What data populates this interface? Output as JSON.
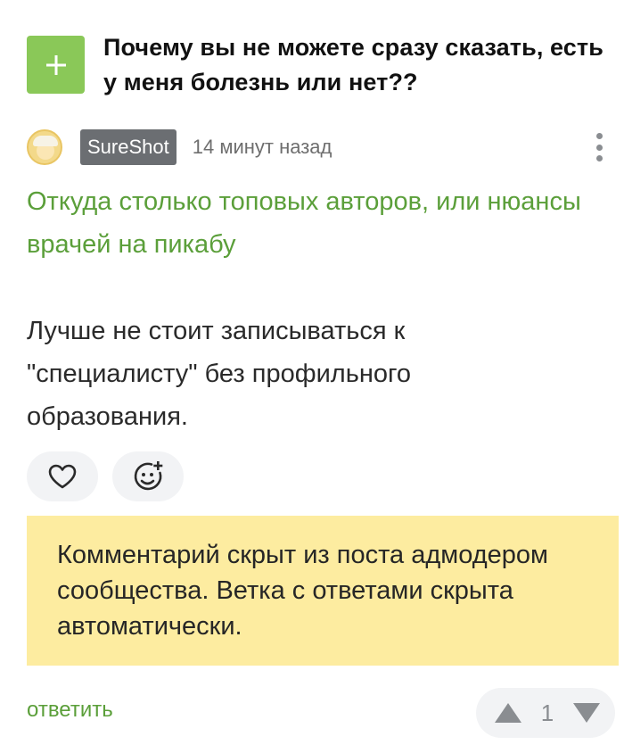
{
  "post": {
    "title": "Почему вы не можете сразу сказать, есть у меня болезнь или нет??"
  },
  "comment": {
    "username": "SureShot",
    "time": "14 минут назад",
    "quote_link": "Откуда столько топовых авторов, или нюансы врачей на пикабу",
    "body": "Лучше не стоит записываться к \"специалисту\" без профильного образования."
  },
  "hidden_notice": "Комментарий скрыт из поста адмодером сообщества. Ветка с ответами скрыта автоматически.",
  "footer": {
    "reply_label": "ответить",
    "rating": "1"
  },
  "colors": {
    "accent_green": "#8ac858",
    "link_green": "#5b9f3a",
    "notice_yellow": "#fdeca0",
    "username_badge": "#6b6e72"
  },
  "icons": [
    "plus-icon",
    "avatar",
    "more-vertical-icon",
    "heart-icon",
    "add-reaction-icon",
    "arrow-up-icon",
    "arrow-down-icon"
  ]
}
